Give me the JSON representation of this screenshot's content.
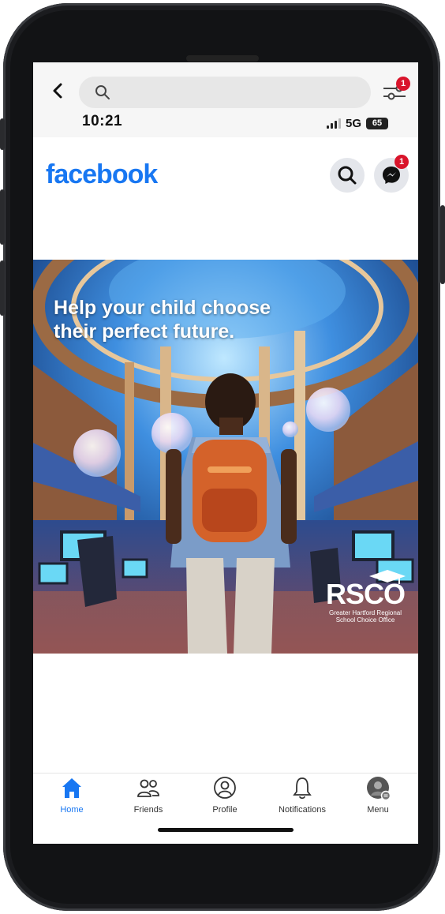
{
  "status_bar": {
    "time": "10:21",
    "network": "5G",
    "battery": "65"
  },
  "browser": {
    "search_placeholder": "",
    "filter_badge": "1"
  },
  "app": {
    "name": "facebook",
    "messenger_badge": "1"
  },
  "post": {
    "headline_line1": "Help your child choose",
    "headline_line2": "their perfect future.",
    "brand_name": "RSCO",
    "brand_sub_line1": "Greater Hartford Regional",
    "brand_sub_line2": "School Choice Office"
  },
  "nav": [
    {
      "label": "Home",
      "icon": "home-icon",
      "active": true
    },
    {
      "label": "Friends",
      "icon": "friends-icon",
      "active": false
    },
    {
      "label": "Profile",
      "icon": "profile-icon",
      "active": false
    },
    {
      "label": "Notifications",
      "icon": "bell-icon",
      "active": false
    },
    {
      "label": "Menu",
      "icon": "avatar-menu-icon",
      "active": false
    }
  ],
  "colors": {
    "brand": "#1877f2",
    "badge": "#d9142b"
  }
}
